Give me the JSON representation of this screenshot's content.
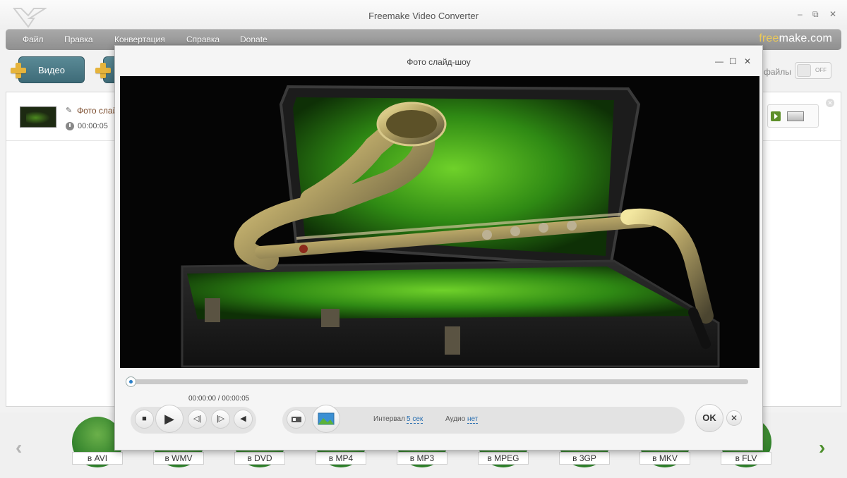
{
  "window": {
    "title": "Freemake Video Converter",
    "minimize": "–",
    "restore": "⧉",
    "close": "✕"
  },
  "menu": {
    "items": [
      "Файл",
      "Правка",
      "Конвертация",
      "Справка",
      "Donate"
    ],
    "brand_free": "free",
    "brand_rest": "make.com"
  },
  "toolbar": {
    "video_label": "Видео",
    "files_label": "файлы",
    "toggle_label": "OFF"
  },
  "file_list": {
    "item": {
      "name": "Фото слай",
      "duration": "00:00:05"
    },
    "close": "✕"
  },
  "dialog": {
    "title": "Фото слайд-шоу",
    "minimize": "—",
    "maximize": "☐",
    "close": "✕",
    "timecode": "00:00:00 / 00:00:05",
    "controls": {
      "stop": "■",
      "play": "▶",
      "prev": "◁|",
      "next": "|▷",
      "volume": "◀"
    },
    "interval_label": "Интервал",
    "interval_value": "5 сек",
    "audio_label": "Аудио",
    "audio_value": "нет",
    "ok_label": "OK",
    "close_btn": "✕"
  },
  "formats": {
    "prev_arrow": "‹",
    "next_arrow": "›",
    "items": [
      "в AVI",
      "в WMV",
      "в DVD",
      "в MP4",
      "в MP3",
      "в MPEG",
      "в 3GP",
      "в MKV",
      "в FLV"
    ],
    "accent_color": "#3e8a2e",
    "arrow_color_left": "#b5b5b5",
    "arrow_color_right": "#4c8e2b"
  }
}
